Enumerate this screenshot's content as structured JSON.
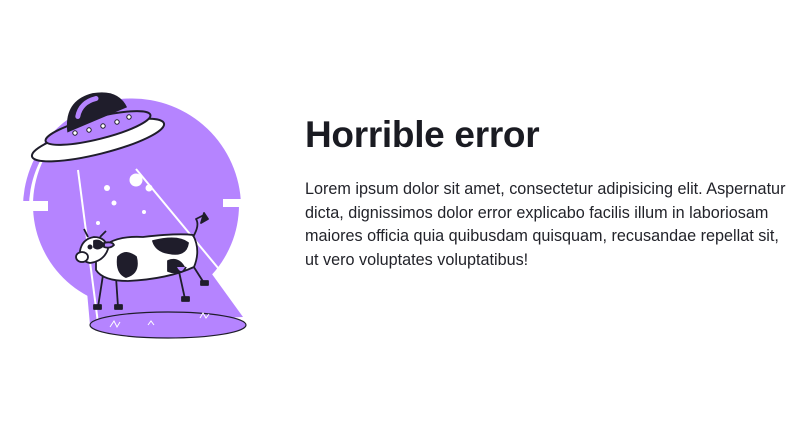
{
  "error_page": {
    "title": "Horrible error",
    "message": "Lorem ipsum dolor sit amet, consectetur adipisicing elit. Aspernatur dicta, dignissimos dolor error explicabo facilis illum in laboriosam maiores officia quia quibusdam quisquam, recusandae repellat sit, ut vero voluptates voluptatibus!"
  },
  "illustration": {
    "icon": "ufo-abducting-cow-icon"
  },
  "colors": {
    "accent": "#b584ff",
    "outline": "#1f1d2b",
    "text": "#22232a",
    "background": "#ffffff"
  }
}
